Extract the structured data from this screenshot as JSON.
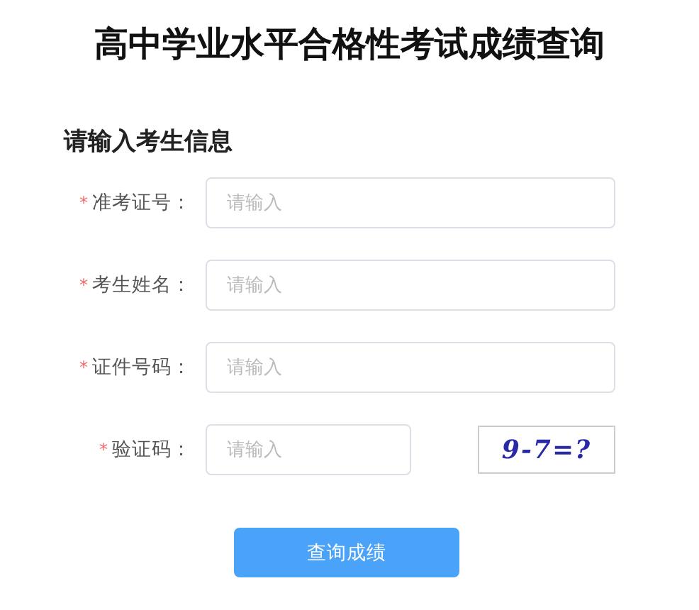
{
  "title": "高中学业水平合格性考试成绩查询",
  "section_title": "请输入考生信息",
  "fields": [
    {
      "label": "准考证号：",
      "required_mark": "*",
      "placeholder": "请输入",
      "kind": "text"
    },
    {
      "label": "考生姓名：",
      "required_mark": "*",
      "placeholder": "请输入",
      "kind": "text"
    },
    {
      "label": "证件号码：",
      "required_mark": "*",
      "placeholder": "请输入",
      "kind": "text"
    },
    {
      "label": "验证码：",
      "required_mark": "*",
      "placeholder": "请输入",
      "kind": "captcha",
      "captcha_text": "9-7=?"
    }
  ],
  "submit_button": "查询成绩"
}
